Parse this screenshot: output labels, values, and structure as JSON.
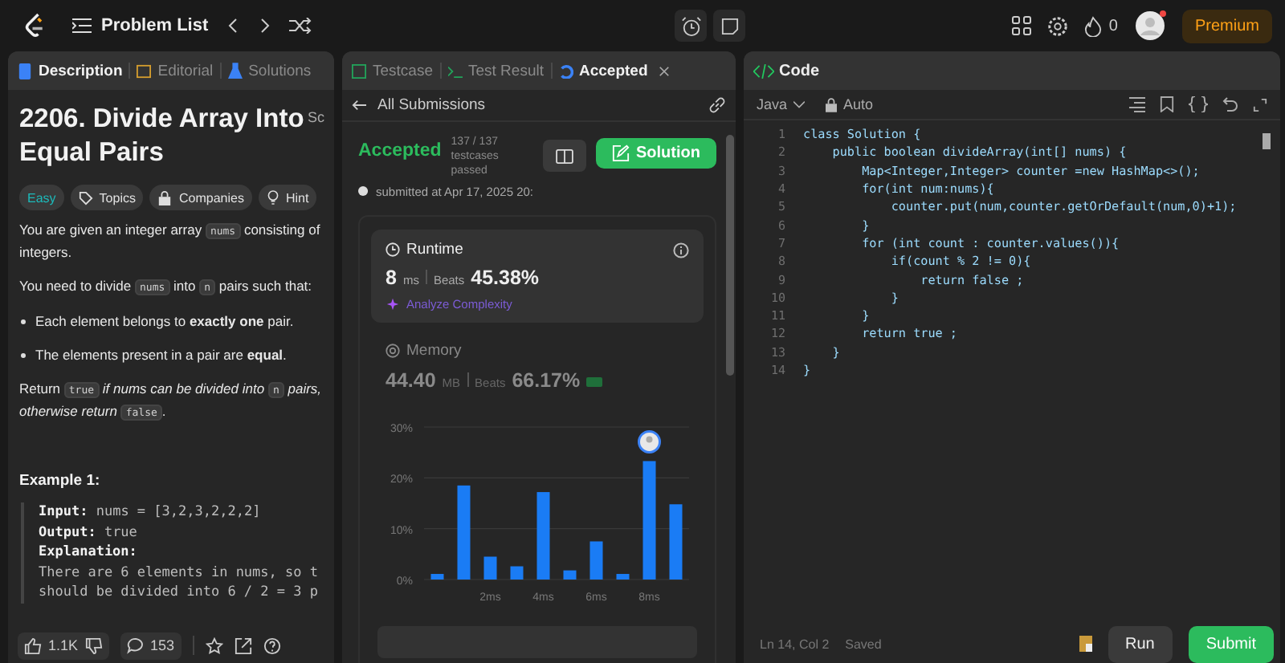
{
  "topbar": {
    "problem_list": "Problem List",
    "streak": "0",
    "premium": "Premium"
  },
  "description_panel": {
    "tabs": [
      {
        "label": "Description",
        "selected": true
      },
      {
        "label": "Editorial",
        "selected": false
      },
      {
        "label": "Solutions",
        "selected": false
      }
    ],
    "title": "2206. Divide Array Into Equal Pairs",
    "title_side_text": "Sc",
    "tags": [
      {
        "label": "Easy",
        "kind": "difficulty"
      },
      {
        "label": "Topics",
        "kind": "tag"
      },
      {
        "label": "Companies",
        "kind": "lock"
      },
      {
        "label": "Hint",
        "kind": "bulb"
      }
    ],
    "paragraphs": [
      {
        "kind": "para",
        "segments": [
          {
            "kind": "text",
            "text": "You are given an integer array "
          },
          {
            "kind": "code",
            "text": "nums"
          },
          {
            "kind": "text",
            "text": " consisting of integers."
          }
        ]
      },
      {
        "kind": "para",
        "segments": [
          {
            "kind": "text",
            "text": "You need to divide "
          },
          {
            "kind": "code",
            "text": "nums"
          },
          {
            "kind": "text",
            "text": " into "
          },
          {
            "kind": "code",
            "text": "n"
          },
          {
            "kind": "text",
            "text": " pairs such that:"
          }
        ]
      },
      {
        "kind": "bullet",
        "segments": [
          {
            "kind": "text",
            "text": "Each element belongs to **exactly one** pair."
          }
        ]
      },
      {
        "kind": "bullet",
        "segments": [
          {
            "kind": "text",
            "text": "The elements present in a pair are **equal**."
          }
        ]
      },
      {
        "kind": "para",
        "segments": [
          {
            "kind": "text",
            "text": "Return "
          },
          {
            "kind": "code",
            "text": "true"
          },
          {
            "kind": "text",
            "text": " *if nums can be divided into* "
          },
          {
            "kind": "code",
            "text": "n"
          },
          {
            "kind": "text",
            "text": " *pairs, otherwise return* "
          },
          {
            "kind": "code",
            "text": "false"
          },
          {
            "kind": "text",
            "text": "."
          }
        ]
      }
    ],
    "example_title": "Example 1:",
    "example_lines": [
      "**Input:** nums = [3,2,3,2,2,2]",
      "**Output:** true",
      "**Explanation:**",
      "There are 6 elements in nums, so t",
      "should be divided into 6 / 2 = 3 p"
    ],
    "likes": "1.1K",
    "comments": "153"
  },
  "result_panel": {
    "tabs": [
      {
        "label": "Testcase",
        "selected": false
      },
      {
        "label": "Test Result",
        "selected": false
      },
      {
        "label": "Accepted",
        "selected": true
      }
    ],
    "back_label": "All Submissions",
    "status": "Accepted",
    "testcases": "137 / 137 testcases passed",
    "submitted": "submitted at Apr 17, 2025 20:",
    "solution_button": "Solution",
    "runtime": {
      "label": "Runtime",
      "value": "8",
      "unit": "ms",
      "beats_label": "Beats",
      "beats": "45.38%",
      "analyze": "Analyze Complexity"
    },
    "memory": {
      "label": "Memory",
      "value": "44.40",
      "unit": "MB",
      "beats_label": "Beats",
      "beats": "66.17%"
    },
    "chart_data": {
      "type": "bar",
      "x": [
        0,
        1,
        2,
        3,
        4,
        5,
        6,
        7,
        8,
        9
      ],
      "values": [
        1.1,
        18.5,
        4.5,
        2.6,
        17.2,
        1.8,
        7.5,
        1.1,
        23.3,
        14.8
      ],
      "xticks": [
        {
          "value": 2,
          "label": "2ms"
        },
        {
          "value": 4,
          "label": "4ms"
        },
        {
          "value": 6,
          "label": "6ms"
        },
        {
          "value": 8,
          "label": "8ms"
        }
      ],
      "yticks": [
        {
          "value": 0,
          "label": "0%"
        },
        {
          "value": 10,
          "label": "10%"
        },
        {
          "value": 20,
          "label": "20%"
        },
        {
          "value": 30,
          "label": "30%"
        }
      ],
      "xlim": [
        -0.5,
        9.5
      ],
      "ylim": [
        0,
        30
      ]
    }
  },
  "code_panel": {
    "title": "Code",
    "language": "Java",
    "mode": "Auto",
    "lines": [
      {
        "number": "1",
        "text": "class Solution {"
      },
      {
        "number": "2",
        "text": "    public boolean divideArray(int[] nums) {"
      },
      {
        "number": "3",
        "text": "        Map<Integer,Integer> counter =new HashMap<>();"
      },
      {
        "number": "4",
        "text": "        for(int num:nums){"
      },
      {
        "number": "5",
        "text": "            counter.put(num,counter.getOrDefault(num,0)+1);"
      },
      {
        "number": "6",
        "text": "        }"
      },
      {
        "number": "7",
        "text": "        for (int count : counter.values()){"
      },
      {
        "number": "8",
        "text": "            if(count % 2 != 0){"
      },
      {
        "number": "9",
        "text": "                return false ;"
      },
      {
        "number": "10",
        "text": "            }"
      },
      {
        "number": "11",
        "text": "        }"
      },
      {
        "number": "12",
        "text": "        return true ;"
      },
      {
        "number": "13",
        "text": "    }"
      },
      {
        "number": "14",
        "text": "}"
      }
    ],
    "cursor": "Ln 14, Col 2",
    "saved": "Saved",
    "run": "Run",
    "submit": "Submit"
  }
}
